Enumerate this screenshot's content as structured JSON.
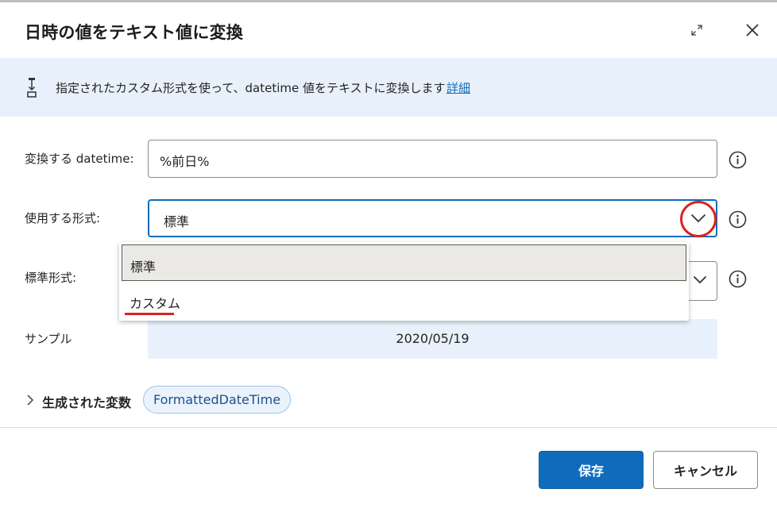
{
  "dialog": {
    "title": "日時の値をテキスト値に変換"
  },
  "banner": {
    "text": "指定されたカスタム形式を使って、datetime 値をテキストに変換します",
    "link": "詳細"
  },
  "fields": {
    "datetime": {
      "label": "変換する datetime:",
      "value": "%前日%"
    },
    "format": {
      "label": "使用する形式:",
      "value": "標準"
    },
    "standard_format": {
      "label": "標準形式:"
    },
    "sample": {
      "label": "サンプル",
      "value": "2020/05/19"
    }
  },
  "dropdown": {
    "options": [
      "標準",
      "カスタム"
    ],
    "selected": "標準"
  },
  "generated": {
    "label": "生成された変数",
    "variable": "FormattedDateTime"
  },
  "buttons": {
    "save": "保存",
    "cancel": "キャンセル"
  },
  "colors": {
    "accent": "#0f6cbd",
    "banner_bg": "#e8f1fb",
    "highlight_red": "#d9241c"
  },
  "icons": [
    "expand-icon",
    "close-icon",
    "flow-step-icon",
    "info-icon",
    "chevron-down-icon",
    "chevron-right-icon"
  ]
}
